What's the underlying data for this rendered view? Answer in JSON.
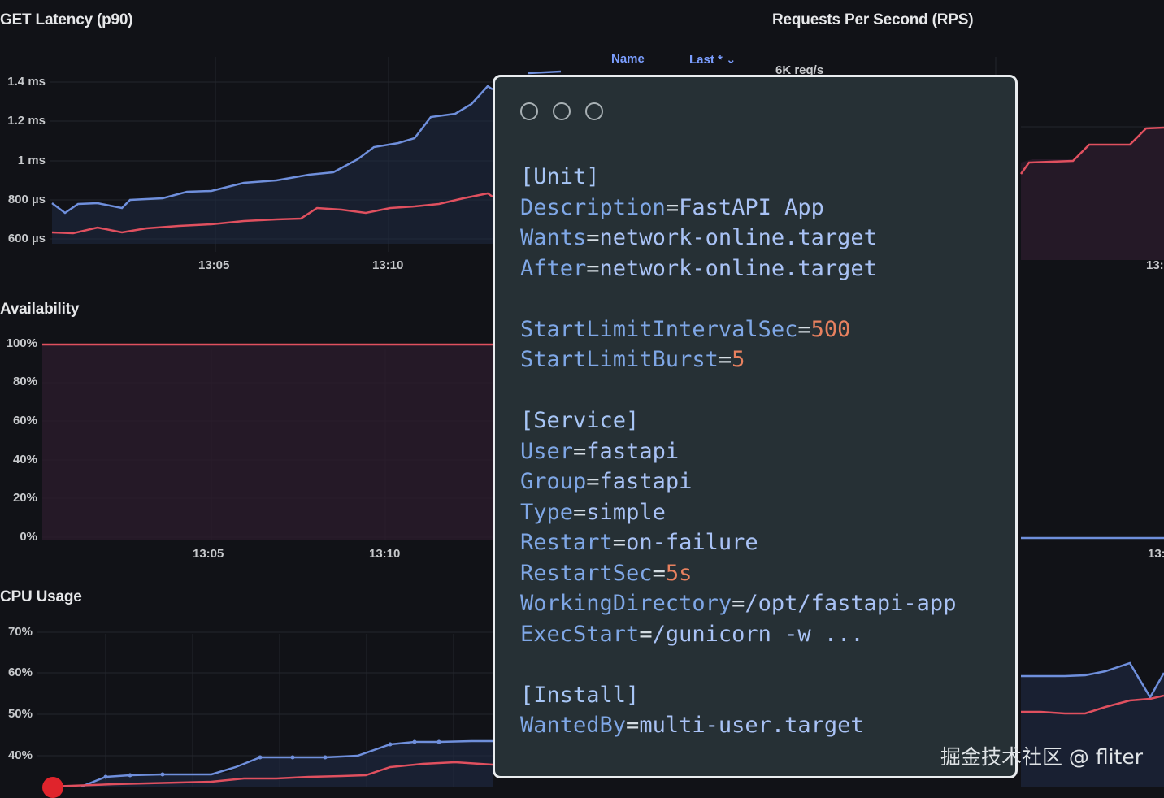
{
  "dashboard": {
    "latency": {
      "title": "GET Latency (p90)",
      "yticks": [
        "1.4 ms",
        "1.2 ms",
        "1 ms",
        "800 µs",
        "600 µs"
      ],
      "xticks": [
        "13:05",
        "13:10"
      ]
    },
    "availability": {
      "title": "Availability",
      "yticks": [
        "100%",
        "80%",
        "60%",
        "40%",
        "20%",
        "0%"
      ],
      "xticks": [
        "13:05",
        "13:10"
      ]
    },
    "cpu": {
      "title": "CPU Usage",
      "yticks": [
        "70%",
        "60%",
        "50%",
        "40%"
      ]
    },
    "rps": {
      "title": "Requests Per Second (RPS)",
      "legend_name": "Name",
      "legend_last": "Last * ⌄",
      "first_tick": "6K req/s",
      "xtick_1": "13:",
      "xtick_2": "13:"
    },
    "colors": {
      "series_blue": "#6f8fdc",
      "series_red": "#e0505f",
      "background": "#111217"
    }
  },
  "editor": {
    "window_controls": [
      "close-circle-icon",
      "minimize-circle-icon",
      "maximize-circle-icon"
    ],
    "lines": [
      {
        "key": "[Unit]"
      },
      {
        "key": "Description",
        "value": "FastAPI App"
      },
      {
        "key": "Wants",
        "value": "network-online.target"
      },
      {
        "key": "After",
        "value": "network-online.target"
      },
      {},
      {
        "key": "StartLimitIntervalSec",
        "value": "500",
        "numeric": true
      },
      {
        "key": "StartLimitBurst",
        "value": "5",
        "numeric": true
      },
      {},
      {
        "key": "[Service]"
      },
      {
        "key": "User",
        "value": "fastapi"
      },
      {
        "key": "Group",
        "value": "fastapi"
      },
      {
        "key": "Type",
        "value": "simple"
      },
      {
        "key": "Restart",
        "value": "on-failure"
      },
      {
        "key": "RestartSec",
        "value": "5s",
        "numeric": true
      },
      {
        "key": "WorkingDirectory",
        "value": "/opt/fastapi-app"
      },
      {
        "key": "ExecStart",
        "value": "/gunicorn -w ..."
      },
      {},
      {
        "key": "[Install]"
      },
      {
        "key": "WantedBy",
        "value": "multi-user.target"
      }
    ]
  },
  "watermark": "掘金技术社区 @ fliter"
}
